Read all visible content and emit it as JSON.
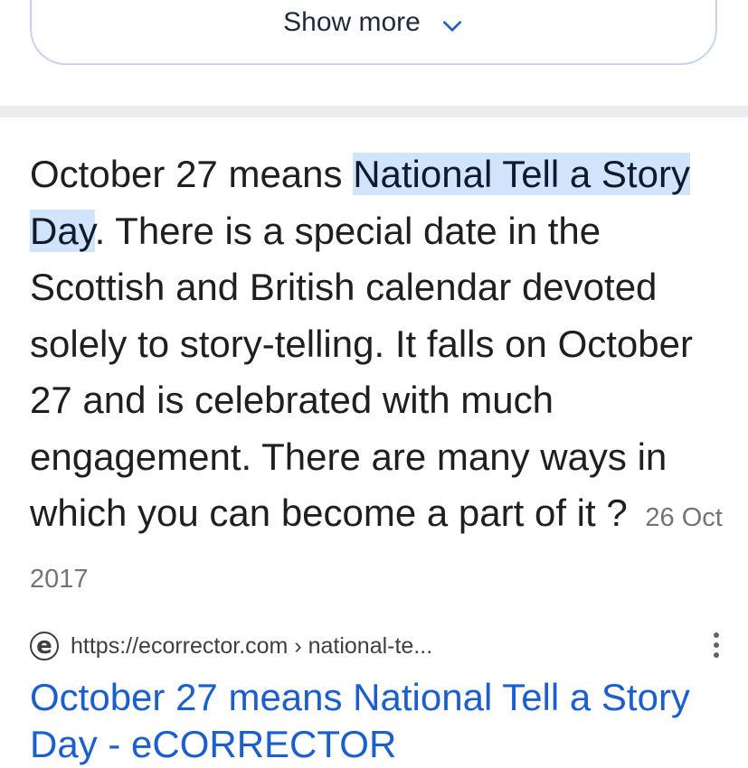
{
  "show_more": {
    "label": "Show more",
    "icon": "chevron-down-icon"
  },
  "snippet": {
    "before": "October 27 means ",
    "highlight": "National Tell a Story Day",
    "after": ". There is a special date in the Scottish and British calendar devoted solely to story-telling. It falls on October 27 and is celebrated with much engagement. There are many ways in which you can become a part of it ?",
    "date": "26 Oct 2017"
  },
  "result": {
    "favicon_letter": "e",
    "url": "https://ecorrector.com › national-te...",
    "title": "October 27 means National Tell a Story Day - eCORRECTOR",
    "menu_icon": "more-vert-icon"
  },
  "colors": {
    "highlight": "#d2e3fc",
    "link": "#1a5fcc",
    "divider": "#ececf1"
  }
}
